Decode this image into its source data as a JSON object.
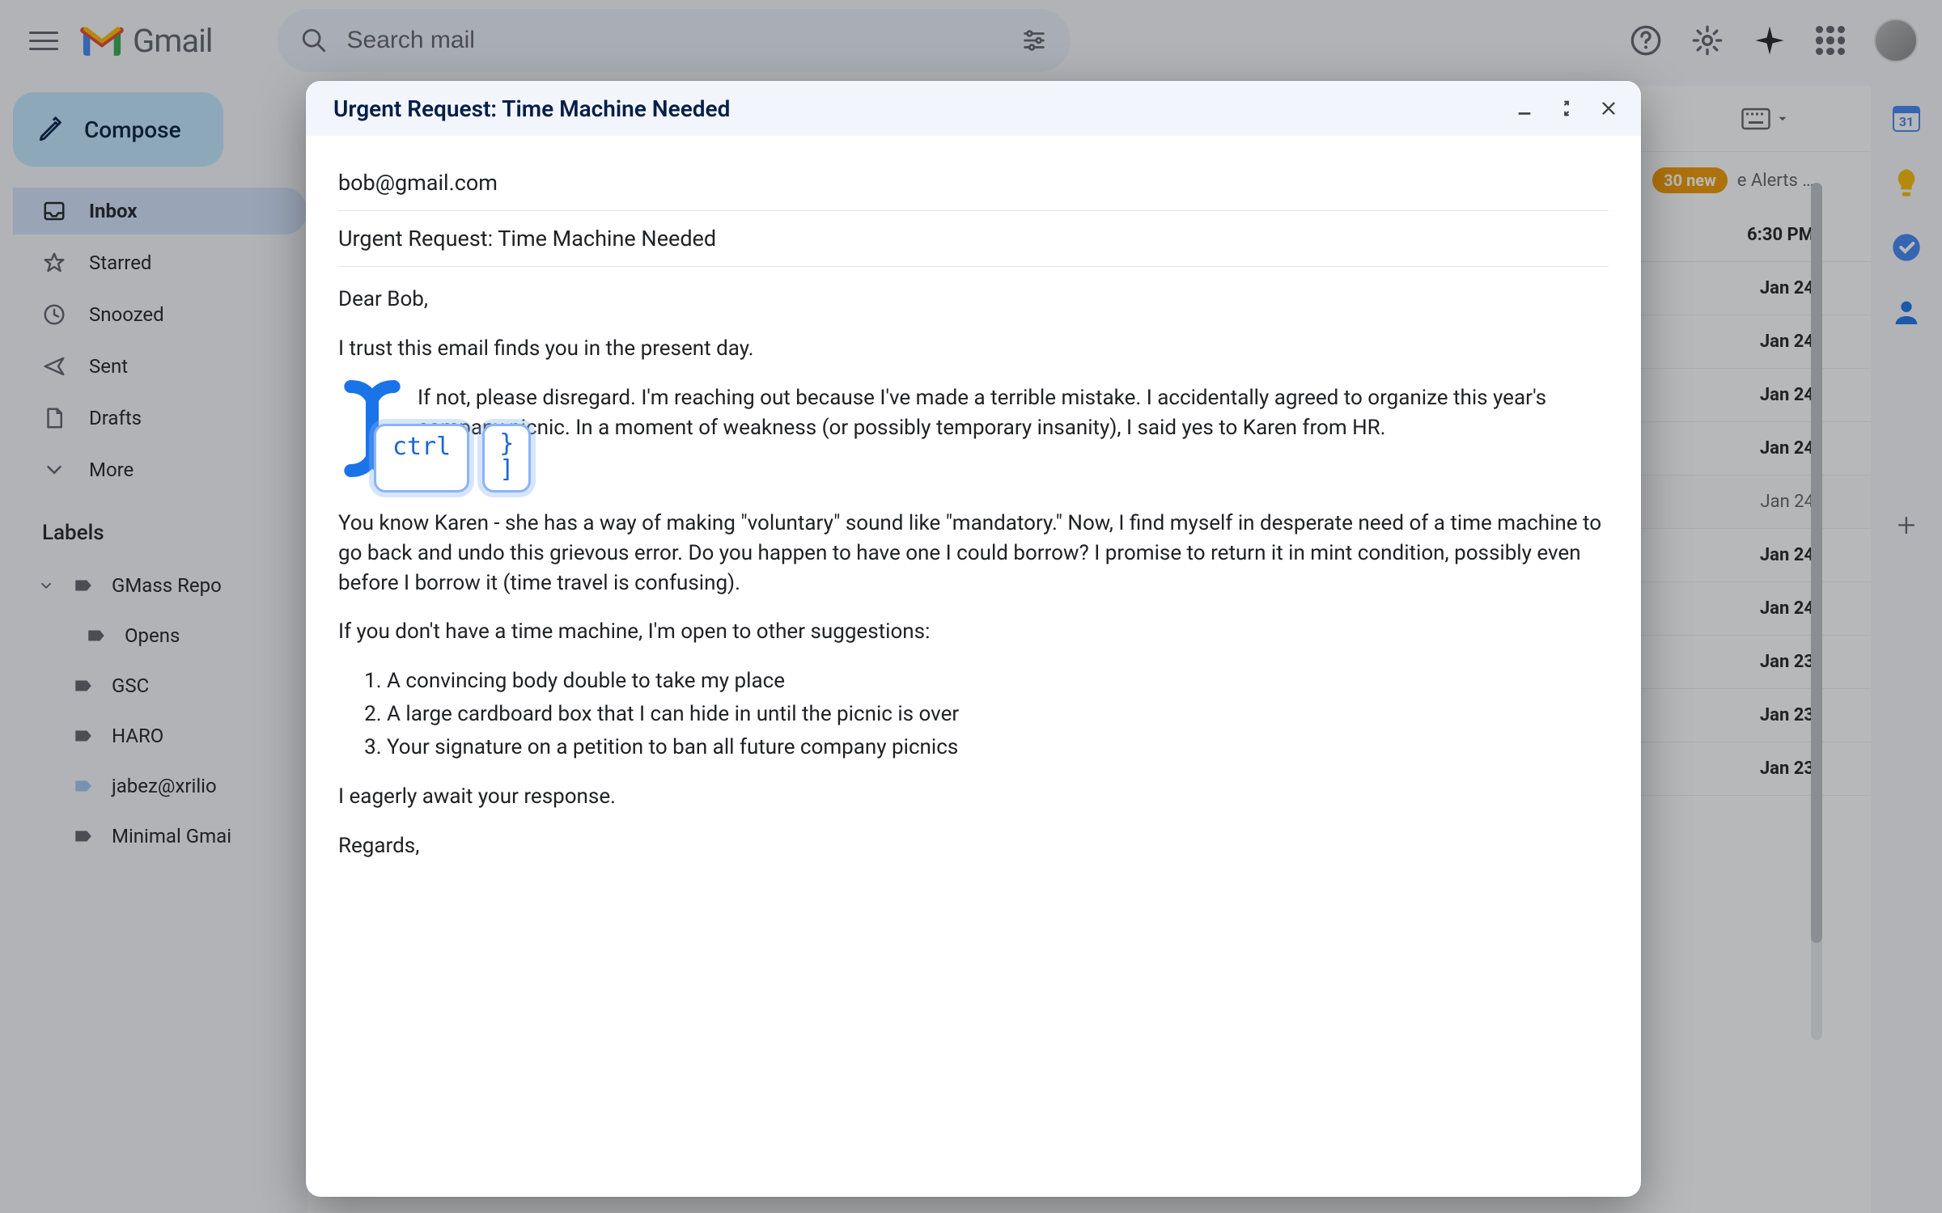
{
  "header": {
    "logo_text": "Gmail",
    "search_placeholder": "Search mail"
  },
  "sidebar": {
    "compose_label": "Compose",
    "items": [
      {
        "label": "Inbox"
      },
      {
        "label": "Starred"
      },
      {
        "label": "Snoozed"
      },
      {
        "label": "Sent"
      },
      {
        "label": "Drafts"
      },
      {
        "label": "More"
      }
    ],
    "labels_header": "Labels",
    "labels": [
      {
        "label": "GMass Repo"
      },
      {
        "label": "Opens"
      },
      {
        "label": "GSC"
      },
      {
        "label": "HARO"
      },
      {
        "label": "jabez@xrilio"
      },
      {
        "label": "Minimal Gmai"
      }
    ]
  },
  "mail_toolbar": {
    "badge_text": "30 new",
    "alerts_text": "e Alerts …"
  },
  "mail_rows": [
    {
      "date": "6:30 PM",
      "read": false
    },
    {
      "date": "Jan 24",
      "read": false
    },
    {
      "date": "Jan 24",
      "read": false
    },
    {
      "date": "Jan 24",
      "read": false
    },
    {
      "date": "Jan 24",
      "read": false
    },
    {
      "date": "Jan 24",
      "read": true
    },
    {
      "date": "Jan 24",
      "read": false
    },
    {
      "date": "Jan 24",
      "read": false
    },
    {
      "date": "Jan 23",
      "read": false
    },
    {
      "date": "Jan 23",
      "read": false
    },
    {
      "date": "Jan 23",
      "read": false
    }
  ],
  "compose": {
    "title": "Urgent Request: Time Machine Needed",
    "to": "bob@gmail.com",
    "subject": "Urgent Request: Time Machine Needed",
    "para1": "Dear Bob,",
    "para2": "I trust this email finds you in the present day.",
    "para3": "If not, please disregard. I'm reaching out because I've made a terrible mistake. I accidentally agreed to organize this year's company picnic. In a moment of weakness (or possibly temporary insanity), I said yes to Karen from HR.",
    "para4": "You know Karen - she has a way of making \"voluntary\" sound like \"mandatory.\" Now, I find myself in desperate need of a time machine to go back and undo this grievous error. Do you happen to have one I could borrow? I promise to return it in mint condition, possibly even before I borrow it (time travel is confusing).",
    "para5": "If you don't have a time machine, I'm open to other suggestions:",
    "suggestions": [
      "A convincing body double to take my place",
      "A large cardboard box that I can hide in until the picnic is over",
      "Your signature on a petition to ban all future company picnics"
    ],
    "para6": "I eagerly await your response.",
    "para7": "Regards,"
  },
  "keycaps": {
    "ctrl": "ctrl",
    "bracket": "}\n]"
  }
}
